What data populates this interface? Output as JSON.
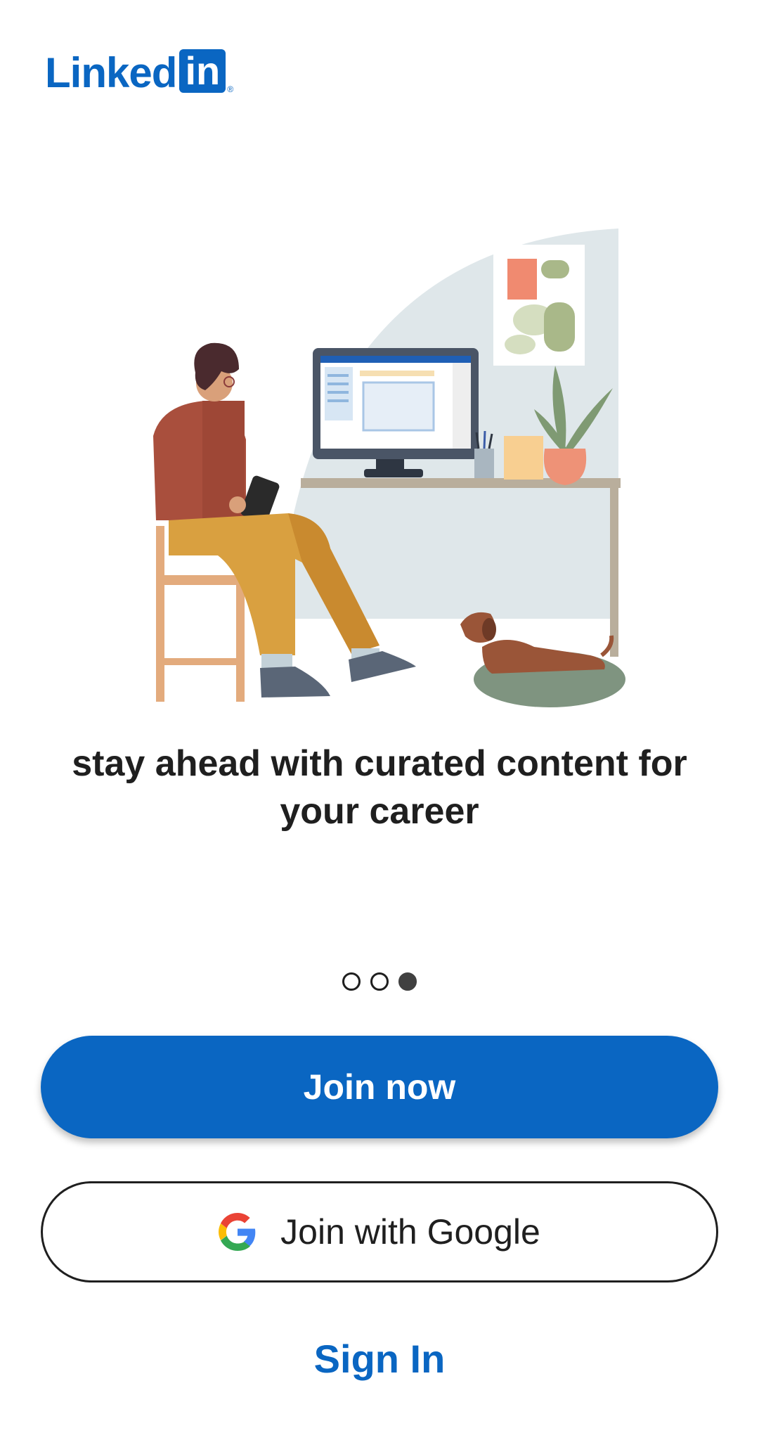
{
  "brand": {
    "logo_word": "Linked",
    "logo_box": "in",
    "logo_mark": "®",
    "color": "#0a66c2"
  },
  "carousel": {
    "headline": "stay ahead with curated content for your career",
    "page_count": 3,
    "active_index": 2
  },
  "buttons": {
    "join_now": "Join now",
    "join_google": "Join with Google",
    "google_icon": "google-g-icon",
    "sign_in": "Sign In"
  }
}
